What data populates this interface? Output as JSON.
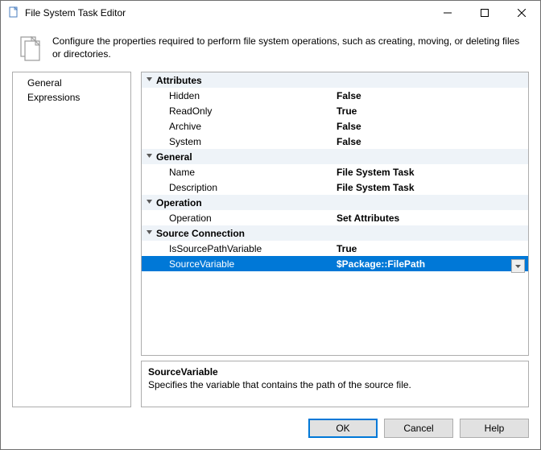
{
  "window": {
    "title": "File System Task Editor"
  },
  "intro": {
    "text": "Configure the properties required to perform file system operations, such as creating, moving, or deleting files or directories."
  },
  "sidebar": {
    "items": [
      {
        "label": "General"
      },
      {
        "label": "Expressions"
      }
    ]
  },
  "grid": {
    "categories": [
      {
        "name": "Attributes",
        "props": [
          {
            "label": "Hidden",
            "value": "False"
          },
          {
            "label": "ReadOnly",
            "value": "True"
          },
          {
            "label": "Archive",
            "value": "False"
          },
          {
            "label": "System",
            "value": "False"
          }
        ]
      },
      {
        "name": "General",
        "props": [
          {
            "label": "Name",
            "value": "File System Task"
          },
          {
            "label": "Description",
            "value": "File System Task"
          }
        ]
      },
      {
        "name": "Operation",
        "props": [
          {
            "label": "Operation",
            "value": "Set Attributes"
          }
        ]
      },
      {
        "name": "Source Connection",
        "props": [
          {
            "label": "IsSourcePathVariable",
            "value": "True"
          },
          {
            "label": "SourceVariable",
            "value": "$Package::FilePath",
            "selected": true,
            "dropdown": true
          }
        ]
      }
    ]
  },
  "description": {
    "title": "SourceVariable",
    "text": "Specifies the variable that contains the path of the source file."
  },
  "footer": {
    "ok": "OK",
    "cancel": "Cancel",
    "help": "Help"
  }
}
